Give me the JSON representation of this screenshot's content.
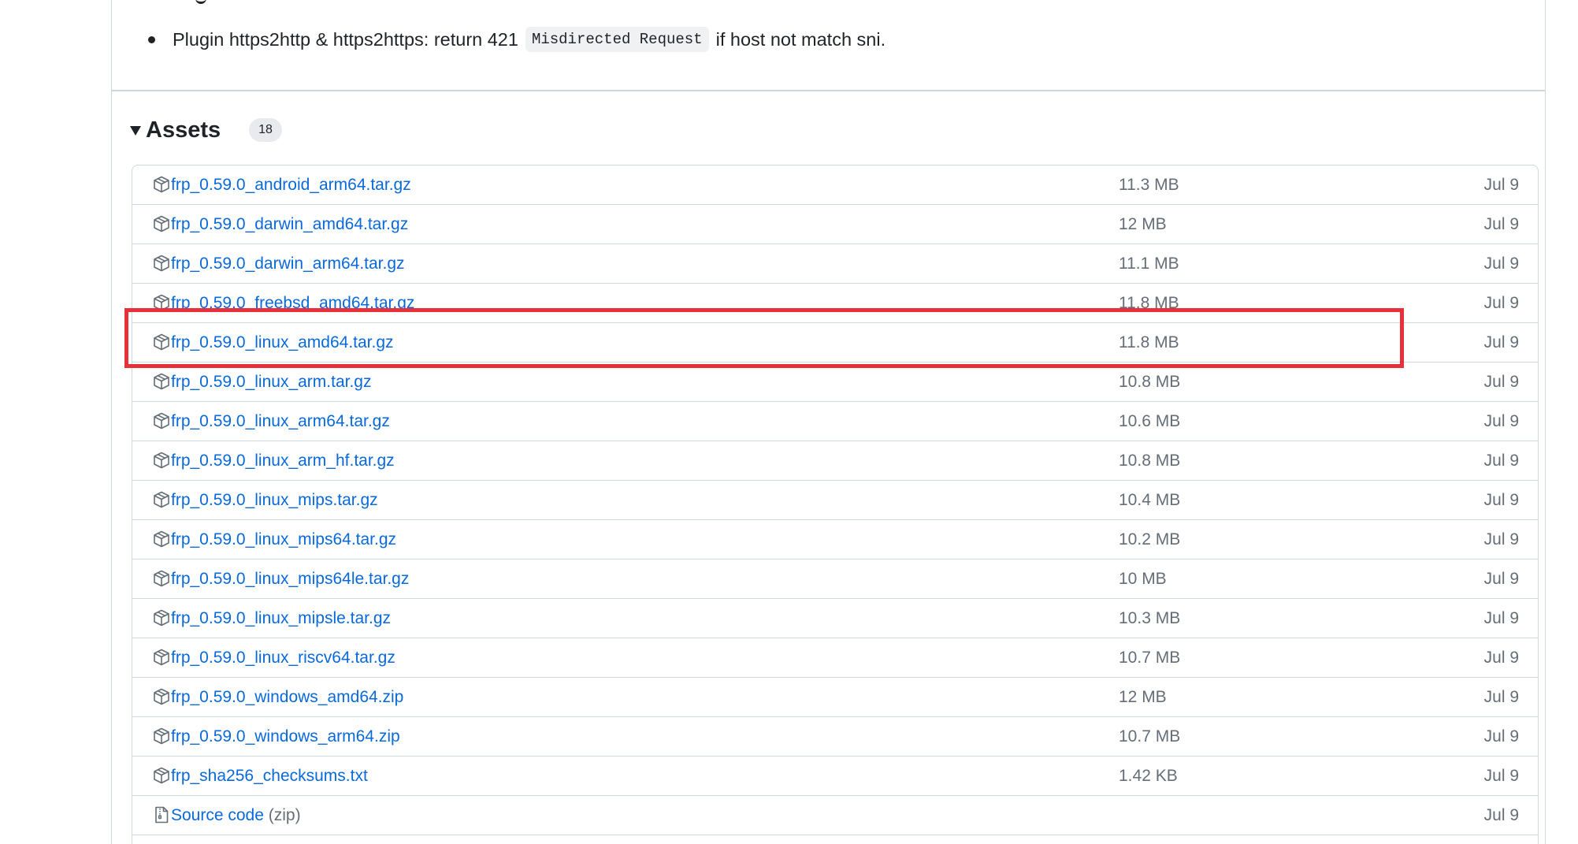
{
  "release_notes": {
    "bullet_text_before": "Plugin https2http & https2https: return 421",
    "code": "Misdirected Request",
    "bullet_text_after": "if host not match sni."
  },
  "assets": {
    "title": "Assets",
    "count": "18",
    "items": [
      {
        "name": "frp_0.59.0_android_arm64.tar.gz",
        "size": "11.3 MB",
        "date": "Jul 9",
        "icon": "package-icon"
      },
      {
        "name": "frp_0.59.0_darwin_amd64.tar.gz",
        "size": "12 MB",
        "date": "Jul 9",
        "icon": "package-icon"
      },
      {
        "name": "frp_0.59.0_darwin_arm64.tar.gz",
        "size": "11.1 MB",
        "date": "Jul 9",
        "icon": "package-icon"
      },
      {
        "name": "frp_0.59.0_freebsd_amd64.tar.gz",
        "size": "11.8 MB",
        "date": "Jul 9",
        "icon": "package-icon"
      },
      {
        "name": "frp_0.59.0_linux_amd64.tar.gz",
        "size": "11.8 MB",
        "date": "Jul 9",
        "icon": "package-icon"
      },
      {
        "name": "frp_0.59.0_linux_arm.tar.gz",
        "size": "10.8 MB",
        "date": "Jul 9",
        "icon": "package-icon"
      },
      {
        "name": "frp_0.59.0_linux_arm64.tar.gz",
        "size": "10.6 MB",
        "date": "Jul 9",
        "icon": "package-icon"
      },
      {
        "name": "frp_0.59.0_linux_arm_hf.tar.gz",
        "size": "10.8 MB",
        "date": "Jul 9",
        "icon": "package-icon"
      },
      {
        "name": "frp_0.59.0_linux_mips.tar.gz",
        "size": "10.4 MB",
        "date": "Jul 9",
        "icon": "package-icon"
      },
      {
        "name": "frp_0.59.0_linux_mips64.tar.gz",
        "size": "10.2 MB",
        "date": "Jul 9",
        "icon": "package-icon"
      },
      {
        "name": "frp_0.59.0_linux_mips64le.tar.gz",
        "size": "10 MB",
        "date": "Jul 9",
        "icon": "package-icon"
      },
      {
        "name": "frp_0.59.0_linux_mipsle.tar.gz",
        "size": "10.3 MB",
        "date": "Jul 9",
        "icon": "package-icon"
      },
      {
        "name": "frp_0.59.0_linux_riscv64.tar.gz",
        "size": "10.7 MB",
        "date": "Jul 9",
        "icon": "package-icon"
      },
      {
        "name": "frp_0.59.0_windows_amd64.zip",
        "size": "12 MB",
        "date": "Jul 9",
        "icon": "package-icon"
      },
      {
        "name": "frp_0.59.0_windows_arm64.zip",
        "size": "10.7 MB",
        "date": "Jul 9",
        "icon": "package-icon"
      },
      {
        "name": "frp_sha256_checksums.txt",
        "size": "1.42 KB",
        "date": "Jul 9",
        "icon": "package-icon"
      },
      {
        "name": "Source code",
        "name_suffix": "(zip)",
        "size": "",
        "date": "Jul 9",
        "icon": "file-zip-icon"
      },
      {
        "name": "",
        "size": "",
        "date": "",
        "icon": "file-zip-icon"
      }
    ]
  },
  "colors": {
    "link": "#0969da",
    "muted": "#656d76",
    "border": "#d0d7de",
    "highlight": "#e8303a"
  }
}
